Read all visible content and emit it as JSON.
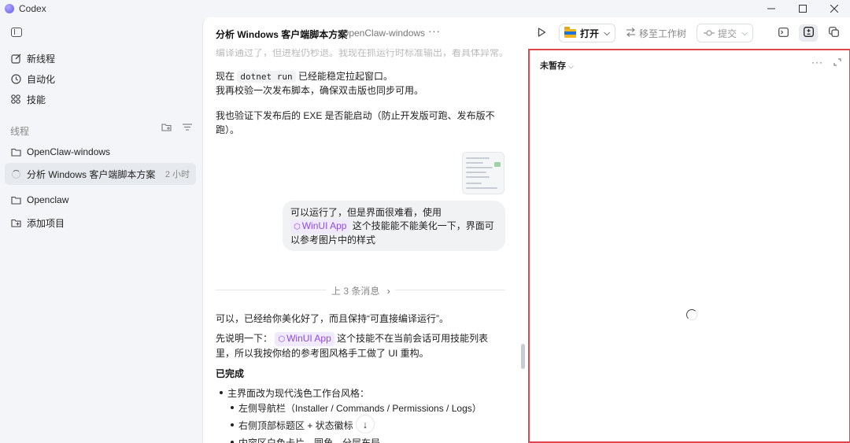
{
  "app": {
    "name": "Codex"
  },
  "sidebar": {
    "nav": [
      {
        "label": "新线程",
        "icon": "edit-icon"
      },
      {
        "label": "自动化",
        "icon": "clock-icon"
      },
      {
        "label": "技能",
        "icon": "grid-icon"
      }
    ],
    "section_title": "线程",
    "threads": [
      {
        "label": "OpenClaw-windows",
        "icon": "folder-icon",
        "time": ""
      },
      {
        "label": "分析 Windows 客户端脚本方案",
        "icon": "loading-spinner-icon",
        "time": "2 小时",
        "active": true
      },
      {
        "label": "Openclaw",
        "icon": "folder-icon",
        "time": ""
      },
      {
        "label": "添加项目",
        "icon": "add-folder-icon",
        "time": ""
      }
    ]
  },
  "header": {
    "title": "分析 Windows 客户端脚本方案",
    "subtitle": "OpenClaw-windows",
    "more": "···",
    "open_label": "打开",
    "move_label": "移至工作树",
    "commit_label": "提交"
  },
  "chat": {
    "faded_line": "编译通过了，但进程仍秒退。我现在抓运行时标准输出，看具体异常。",
    "p1_pre": "现在",
    "p1_code": "dotnet run",
    "p1_post": "已经能稳定拉起窗口。",
    "p2": "我再校验一次发布脚本，确保双击版也同步可用。",
    "p3": "我也验证下发布后的 EXE 是否能启动（防止开发版可跑、发布版不跑）。",
    "user_msg_pre": "可以运行了，但是界面很难看，使用",
    "user_msg_chip": "WinUI App",
    "user_msg_post": "这个技能能不能美化一下，界面可以参考图片中的样式",
    "divider_label": "上 3 条消息",
    "divider_chevron": "›",
    "reply1": "可以，已经给你美化好了，而且保持“可直接编译运行”。",
    "reply2_pre": "先说明一下：",
    "reply2_chip": "WinUI App",
    "reply2_post": "这个技能不在当前会话可用技能列表里，所以我按你给的参考图风格手工做了 UI 重构。",
    "done_heading": "已完成",
    "bullets": [
      "主界面改为现代浅色工作台风格：",
      "左侧导航栏（Installer / Commands / Permissions / Logs）",
      "右侧顶部标题区 + 状态徽标",
      "内容区白色卡片、圆角、分层布局"
    ],
    "scroll_down": "↓"
  },
  "panel": {
    "title": "未暂存",
    "chevron": "⌵",
    "more": "···"
  },
  "colors": {
    "accent": "#8a4fe0",
    "panel_border": "#e0464c",
    "chip_bg": "#f1e9fd"
  }
}
